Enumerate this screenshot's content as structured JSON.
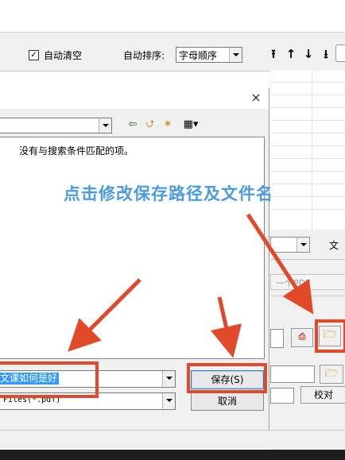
{
  "toolbar": {
    "auto_clear_label": "自动清空",
    "auto_clear_checked": true,
    "sort_label": "自动排序:",
    "sort_value": "字母顺序",
    "move_buttons": [
      "⭱",
      "↑",
      "↓",
      "⭳"
    ]
  },
  "dialog": {
    "close_glyph": "×",
    "empty_message": "没有与搜索条件匹配的项。",
    "file_name_value": "文课如何是好",
    "file_type_value": "Files(*.pdf)",
    "save_label": "保存(S)",
    "cancel_label": "取消"
  },
  "right_panel": {
    "file_label": "文",
    "disabled_value": "一个PDF",
    "proofread_label": "校对"
  },
  "annotation": {
    "text": "点击修改保存路径及文件名",
    "color": "#4a9be0",
    "box_color": "#e04a2a"
  },
  "icons": [
    "checkbox-icon",
    "back-arrow-icon",
    "up-folder-icon",
    "new-folder-icon",
    "view-menu-icon",
    "pdf-icon",
    "browse-folder-icon"
  ]
}
